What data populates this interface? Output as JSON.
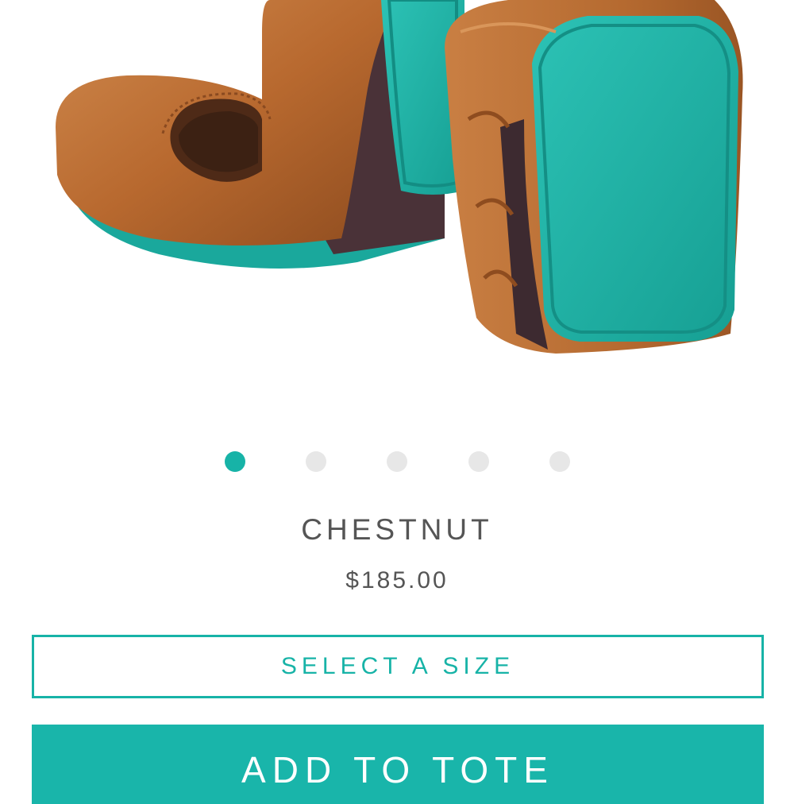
{
  "product": {
    "image_alt": "Chestnut leather ballet flats with teal soles",
    "name": "CHESTNUT",
    "price": "$185.00"
  },
  "carousel": {
    "active_index": 0,
    "count": 5
  },
  "actions": {
    "select_size_label": "SELECT A SIZE",
    "add_to_tote_label": "ADD TO TOTE"
  },
  "colors": {
    "accent": "#17b3a7",
    "leather": "#b8692f",
    "sole": "#1fb0a4",
    "inactive_dot": "#e7e7e7",
    "text": "#555555"
  }
}
